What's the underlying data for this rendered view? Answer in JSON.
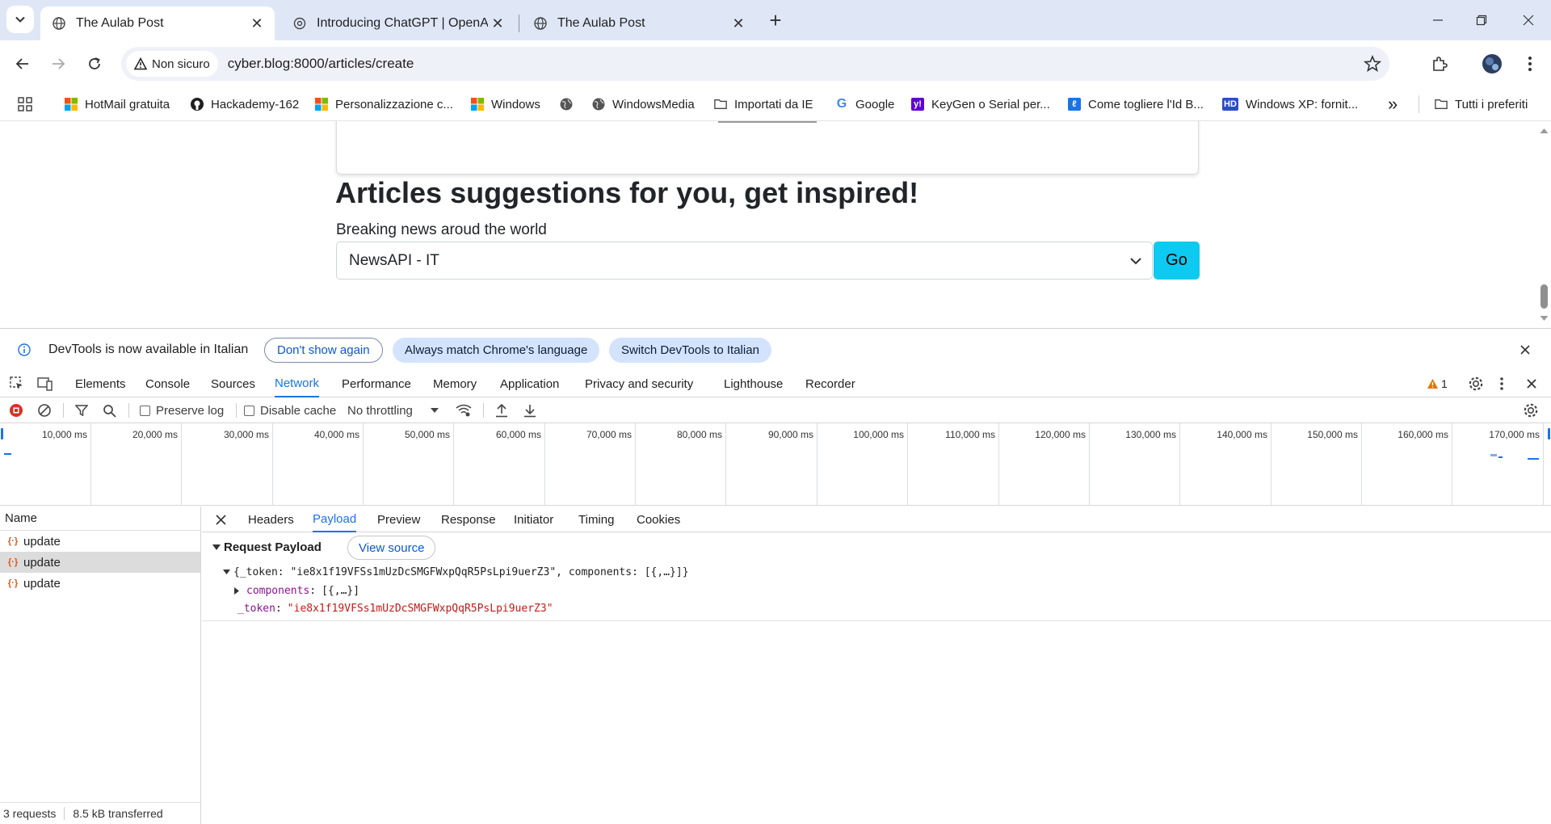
{
  "browser": {
    "tabs": [
      {
        "title": "The Aulab Post",
        "active": true
      },
      {
        "title": "Introducing ChatGPT | OpenAI",
        "active": false
      },
      {
        "title": "The Aulab Post",
        "active": false
      }
    ],
    "new_tab_glyph": "+",
    "security_label": "Non sicuro",
    "url": "cyber.blog:8000/articles/create",
    "bookmarks": [
      {
        "label": "HotMail gratuita",
        "icon": "windows-logo-icon"
      },
      {
        "label": "Hackademy-162",
        "icon": "github-icon"
      },
      {
        "label": "Personalizzazione c...",
        "icon": "windows-logo-icon"
      },
      {
        "label": "Windows",
        "icon": "windows-logo-icon"
      },
      {
        "label": "",
        "icon": "globe-icon"
      },
      {
        "label": "WindowsMedia",
        "icon": "globe-icon"
      },
      {
        "label": "Importati da IE",
        "icon": "folder-icon"
      },
      {
        "label": "Google",
        "icon": "google-icon"
      },
      {
        "label": "KeyGen o Serial per...",
        "icon": "yahoo-icon"
      },
      {
        "label": "Come togliere l'Id B...",
        "icon": "site-icon"
      },
      {
        "label": "Windows XP: fornit...",
        "icon": "hd-icon"
      }
    ],
    "bookmarks_overflow": "»",
    "all_bookmarks": "Tutti i preferiti"
  },
  "page": {
    "heading": "Articles suggestions for you, get inspired!",
    "subheading": "Breaking news aroud the world",
    "select_value": "NewsAPI - IT",
    "go_button": "Go"
  },
  "devtools": {
    "infobar": {
      "message": "DevTools is now available in Italian",
      "dont_show": "Don't show again",
      "always_match": "Always match Chrome's language",
      "switch": "Switch DevTools to Italian"
    },
    "panels": [
      "Elements",
      "Console",
      "Sources",
      "Network",
      "Performance",
      "Memory",
      "Application",
      "Privacy and security",
      "Lighthouse",
      "Recorder"
    ],
    "active_panel": "Network",
    "issues_count": "1",
    "network_toolbar": {
      "preserve_log": "Preserve log",
      "disable_cache": "Disable cache",
      "throttling": "No throttling"
    },
    "timeline_ticks": [
      "10,000 ms",
      "20,000 ms",
      "30,000 ms",
      "40,000 ms",
      "50,000 ms",
      "60,000 ms",
      "70,000 ms",
      "80,000 ms",
      "90,000 ms",
      "100,000 ms",
      "110,000 ms",
      "120,000 ms",
      "130,000 ms",
      "140,000 ms",
      "150,000 ms",
      "160,000 ms",
      "170,000 ms"
    ],
    "name_header": "Name",
    "requests": [
      {
        "name": "update",
        "selected": false
      },
      {
        "name": "update",
        "selected": true
      },
      {
        "name": "update",
        "selected": false
      }
    ],
    "status": {
      "requests": "3 requests",
      "transferred": "8.5 kB transferred"
    },
    "detail_tabs": [
      "Headers",
      "Payload",
      "Preview",
      "Response",
      "Initiator",
      "Timing",
      "Cookies"
    ],
    "active_detail_tab": "Payload",
    "payload": {
      "section_title": "Request Payload",
      "view_source": "View source",
      "summary": "{_token: \"ie8x1f19VFSs1mUzDcSMGFWxpQqR5PsLpi9uerZ3\", components: [{,…}]}",
      "components_key": "components",
      "components_value": "[{,…}]",
      "token_key": "_token",
      "token_value": "\"ie8x1f19VFSs1mUzDcSMGFWxpQqR5PsLpi9uerZ3\""
    }
  },
  "colors": {
    "tabstrip": "#dfe7f7",
    "accent": "#1a73e8",
    "go_button": "#0dcaf0",
    "string_red": "#c41a16",
    "key_purple": "#881391",
    "pill_blue": "#d3e3fd"
  }
}
